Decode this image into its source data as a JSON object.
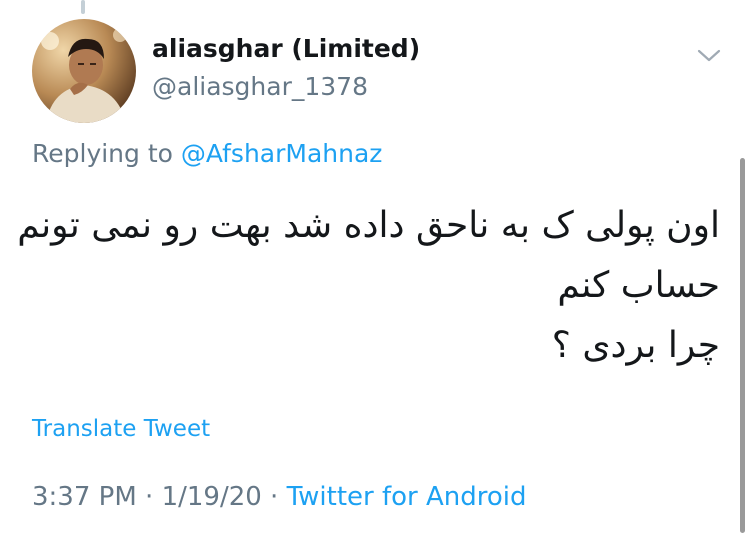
{
  "tweet": {
    "display_name": "aliasghar (Limited)",
    "handle": "@aliasghar_1378",
    "menu_icon": "chevron-down-icon",
    "replying_prefix": "Replying to",
    "replying_to": "@AfsharMahnaz",
    "text_lines": [
      "اون پولی ک به ناحق داده شد بهت رو نمی تونم",
      "حساب کنم",
      "چرا بردی ؟"
    ],
    "translate_label": "Translate Tweet",
    "time": "3:37 PM",
    "separator": " · ",
    "date": "1/19/20",
    "source": "Twitter for Android"
  },
  "colors": {
    "text_primary": "#14171a",
    "text_secondary": "#657786",
    "accent": "#1da1f2"
  }
}
